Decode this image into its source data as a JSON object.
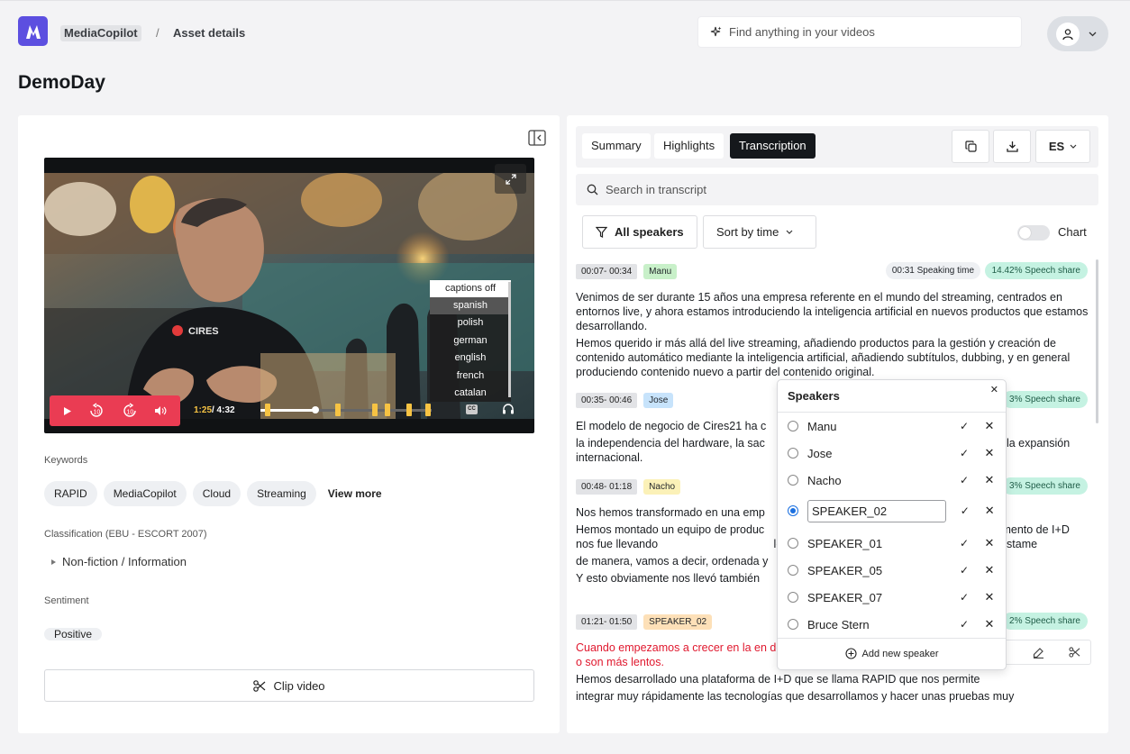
{
  "app": {
    "breadcrumb_root": "MediaCopilot",
    "breadcrumb_current": "Asset details",
    "search_placeholder": "Find anything in your videos"
  },
  "page": {
    "title": "DemoDay"
  },
  "video": {
    "time_current": "1:25",
    "time_total": "/ 4:32",
    "progress": 0.32,
    "captions": {
      "off_label": "captions off",
      "options": [
        "spanish",
        "polish",
        "german",
        "english",
        "french",
        "catalan"
      ],
      "selected": "spanish"
    },
    "brand_text": "CIRES"
  },
  "details": {
    "keywords_label": "Keywords",
    "keywords": [
      "RAPID",
      "MediaCopilot",
      "Cloud",
      "Streaming"
    ],
    "view_more": "View more",
    "classification_label": "Classification (EBU - ESCORT 2007)",
    "classification": "Non-fiction / Information",
    "sentiment_label": "Sentiment",
    "sentiment": "Positive",
    "clip_button": "Clip video"
  },
  "transcript": {
    "tabs": [
      "Summary",
      "Highlights",
      "Transcription"
    ],
    "active_tab": "Transcription",
    "language": "ES",
    "search_placeholder": "Search in transcript",
    "filter_all": "All speakers",
    "sort": "Sort by time",
    "chart_label": "Chart",
    "segments": [
      {
        "time": "00:07- 00:34",
        "speaker": "Manu",
        "speaker_color": "#c8f0c9",
        "speaking_time": "00:31 Speaking time",
        "share": "14.42% Speech share",
        "paragraphs": [
          "Venimos de ser durante 15 años una empresa referente en el mundo del streaming, centrados en entornos live, y ahora estamos introduciendo la inteligencia artificial en nuevos productos que estamos desarrollando.",
          "Hemos querido ir más allá del live streaming, añadiendo productos para la gestión y creación de contenido automático mediante la inteligencia artificial, añadiendo subtítulos, dubbing, y en general produciendo contenido nuevo a partir del contenido original."
        ]
      },
      {
        "time": "00:35- 00:46",
        "speaker": "Jose",
        "speaker_color": "#c7e3fb",
        "share": "3% Speech share",
        "paragraphs": [
          "El modelo de negocio de Cires21 ha c",
          "la independencia del hardware, la sac                                             rticales y el tercero, la expansión internacional."
        ]
      },
      {
        "time": "00:48- 01:18",
        "speaker": "Nacho",
        "speaker_color": "#fbf1b8",
        "share": "3% Speech share",
        "paragraphs": [
          "Nos hemos transformado en una emp                                                  cto.",
          "Hemos montado un equipo de produc                                                  bién del departamento de I+D nos fue llevando                                     le iteraciones y de ciclo de vida del producto justame",
          "de manera, vamos a decir, ordenada y",
          "Y esto obviamente nos llevó también                                                 os."
        ]
      },
      {
        "time": "01:21- 01:50",
        "speaker": "SPEAKER_02",
        "speaker_color": "#fde0b8",
        "share": "2% Speech share",
        "paragraphs_red": "Cuando empezamos a crecer en la en desarrollo de I+D que tienen que ser r                                                  o son más lentos.",
        "paragraphs": [
          "Hemos desarrollado una plataforma de I+D que se llama RAPID que nos permite",
          "integrar muy rápidamente las tecnologías que desarrollamos y hacer unas pruebas muy"
        ]
      }
    ]
  },
  "speakers_popup": {
    "title": "Speakers",
    "speakers": [
      "Manu",
      "Jose",
      "Nacho",
      "SPEAKER_02",
      "SPEAKER_01",
      "SPEAKER_05",
      "SPEAKER_07",
      "Bruce Stern"
    ],
    "editing": "SPEAKER_02",
    "add_label": "Add new speaker"
  },
  "colors": {
    "accent": "#5c4fe0",
    "player": "#ea3c53",
    "marker": "#f6c343",
    "share": "#c5f2e2"
  }
}
